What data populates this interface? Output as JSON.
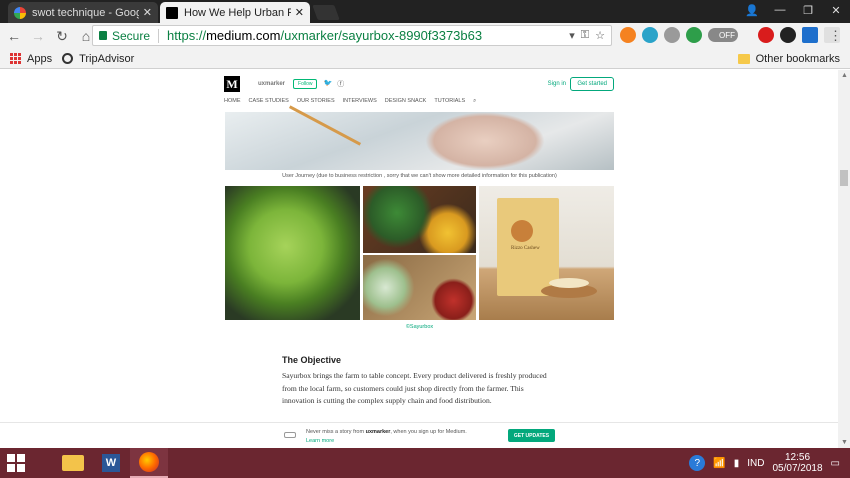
{
  "browser": {
    "tabs": [
      {
        "title": "swot technique - Google",
        "active": false
      },
      {
        "title": "How We Help Urban Peo",
        "active": true
      }
    ],
    "security_label": "Secure",
    "url_scheme": "https://",
    "url_host": "medium.com",
    "url_path": "/uxmarker/sayurbox-8990f3373b63",
    "toggle_label": "OFF",
    "bookmarks": [
      {
        "label": "Apps",
        "icon": "apps-icon"
      },
      {
        "label": "TripAdvisor",
        "icon": "tripadvisor-icon"
      }
    ],
    "other_bookmarks": "Other bookmarks"
  },
  "medium": {
    "logo": "M",
    "publication": "uxmarker",
    "follow": "Follow",
    "signin": "Sign in",
    "get_started": "Get started",
    "nav": [
      "HOME",
      "CASE STUDIES",
      "OUR STORIES",
      "INTERVIEWS",
      "DESIGN SNACK",
      "TUTORIALS"
    ]
  },
  "article": {
    "caption1": "User Journey (due to business restriction , sorry that we can't show more detailed information for this publication)",
    "product_label": "Rizzo Cashew",
    "caption2": "©Sayurbox",
    "heading": "The Objective",
    "body": "Sayurbox brings the farm to table concept. Every product delivered is freshly produced from the local farm, so customers could just shop directly from the farmer. This innovation is cutting the complex supply chain and food distribution."
  },
  "banner": {
    "text_before": "Never miss a story from ",
    "publication": "uxmarker",
    "text_after": ", when you sign up for Medium.",
    "learn_more": "Learn more",
    "button": "GET UPDATES"
  },
  "taskbar": {
    "language": "IND",
    "time": "12:56",
    "date": "05/07/2018"
  },
  "colors": {
    "medium_green": "#03a87c",
    "secure_green": "#0b8043",
    "taskbar": "#6b2630"
  }
}
